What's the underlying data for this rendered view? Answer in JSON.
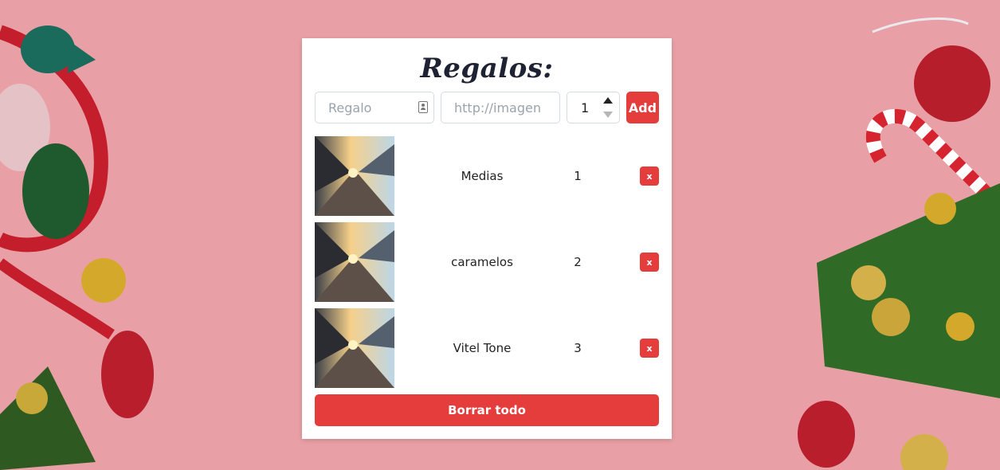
{
  "header": {
    "title": "Regalos:"
  },
  "form": {
    "gift_placeholder": "Regalo",
    "image_placeholder": "http://imagen",
    "quantity_value": "1",
    "add_label": "Add"
  },
  "gifts": [
    {
      "name": "Medias",
      "quantity": "1",
      "remove_label": "x",
      "image_icon": "train-station-photo"
    },
    {
      "name": "caramelos",
      "quantity": "2",
      "remove_label": "x",
      "image_icon": "train-station-photo"
    },
    {
      "name": "Vitel Tone",
      "quantity": "3",
      "remove_label": "x",
      "image_icon": "train-station-photo"
    }
  ],
  "footer": {
    "clear_label": "Borrar todo"
  },
  "colors": {
    "accent": "#e53c3c",
    "background": "#e8a0a6",
    "card": "#ffffff"
  }
}
